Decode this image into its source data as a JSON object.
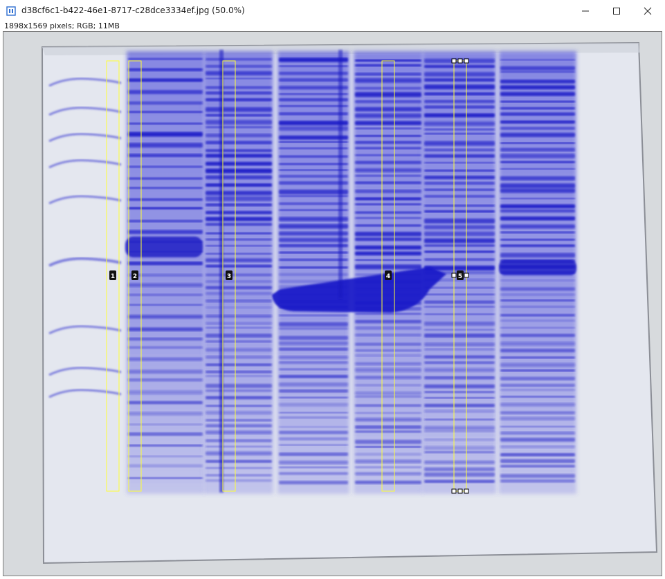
{
  "window": {
    "title": "d38cf6c1-b422-46e1-8717-c28dce3334ef.jpg (50.0%)",
    "info": "1898x1569 pixels; RGB; 11MB",
    "icons": {
      "app": "imagej-icon",
      "minimize": "minimize-icon",
      "maximize": "maximize-icon",
      "close": "close-icon"
    }
  },
  "rois": [
    {
      "label": "1"
    },
    {
      "label": "2"
    },
    {
      "label": "3"
    },
    {
      "label": "4"
    },
    {
      "label": "5"
    }
  ],
  "colors": {
    "gel_background": "#e3e6ee",
    "stain": "#2a2ad4",
    "roi_outline": "#ffff33",
    "label_bg": "#111111"
  }
}
